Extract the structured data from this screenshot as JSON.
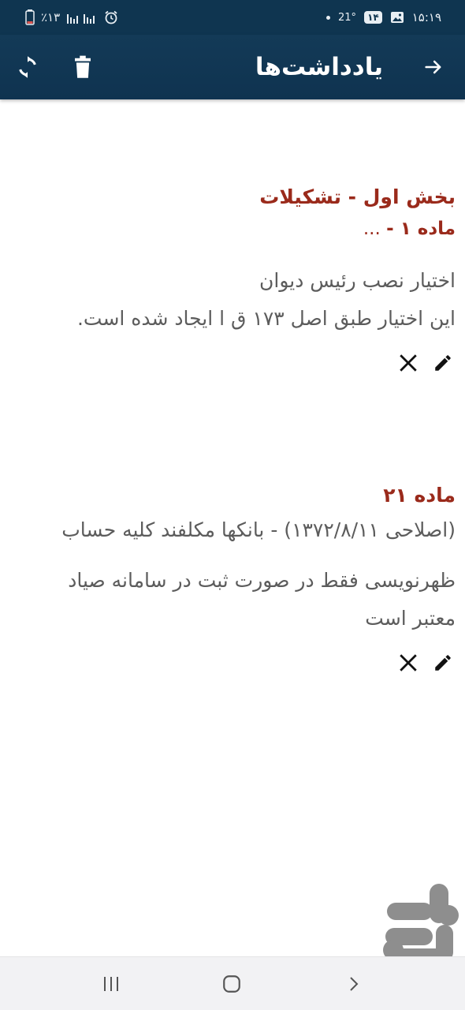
{
  "status_bar": {
    "time": "۱۵:۱۹",
    "badge": "۱۴",
    "temperature": "21°",
    "battery": "٪۱۳",
    "icons": [
      "image-icon",
      "alarm-icon",
      "signal-icon",
      "battery-icon"
    ]
  },
  "app_bar": {
    "title": "یادداشت‌ها",
    "icons": [
      "arrow-right-icon",
      "refresh-icon",
      "trash-icon"
    ]
  },
  "notes": [
    {
      "heading": "بخش اول - تشکیلات",
      "subheading": "ماده ۱ -",
      "subheading_suffix": " ...",
      "lines": [
        "اختیار نصب رئیس دیوان",
        "این اختیار طبق اصل ۱۷۳ ق ا ایجاد شده است."
      ]
    },
    {
      "heading": "ماده ۲۱",
      "intro": "(اصلاحی ۱۳۷۲/۸/۱۱) - بانکها مکلفند کلیه حساب",
      "lines": [
        "ظهرنویسی فقط در صورت ثبت در سامانه صیاد",
        "معتبر است"
      ]
    }
  ],
  "colors": {
    "app_bar": "#0f3550",
    "heading": "#9a2a1b",
    "body_text": "#5c5c5c",
    "watermark": "#7f7f7f"
  },
  "nav": {
    "icons": [
      "recent-apps-icon",
      "home-icon",
      "nav-back-icon"
    ]
  }
}
